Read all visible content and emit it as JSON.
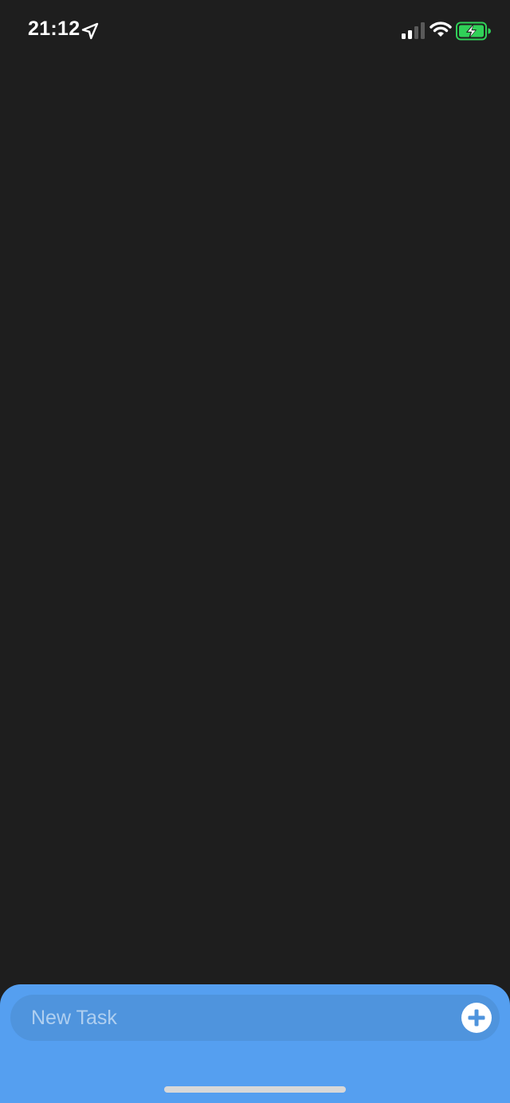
{
  "status_bar": {
    "time": "21:12",
    "location_icon": "location-arrow-icon",
    "signal_icon": "cellular-signal-icon",
    "wifi_icon": "wifi-icon",
    "battery_icon": "battery-charging-icon",
    "battery_color": "#30d158"
  },
  "task_list": {
    "items": []
  },
  "new_task": {
    "placeholder": "New Task",
    "value": "",
    "add_icon": "plus-icon"
  },
  "colors": {
    "background": "#1e1e1e",
    "panel": "#559ff0",
    "field": "#4f94dd",
    "accent": "#4f94dd"
  }
}
